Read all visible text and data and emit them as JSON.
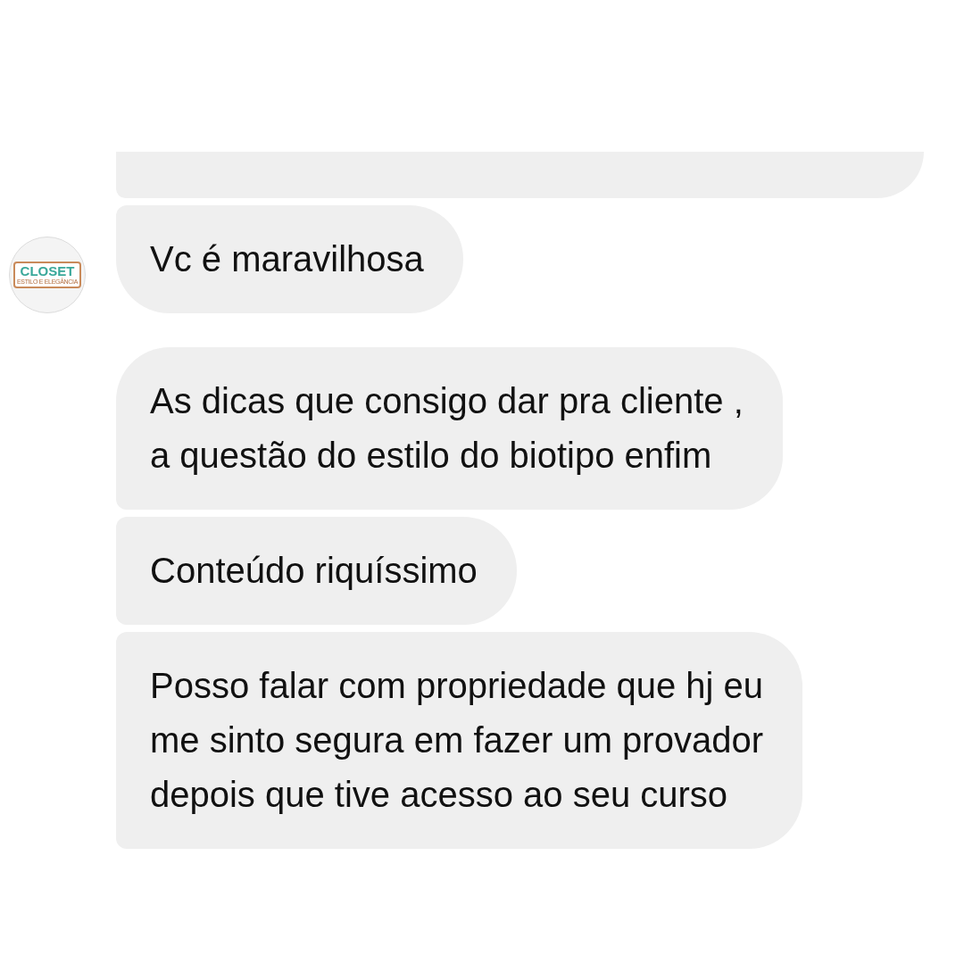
{
  "messages": [
    {
      "group_end": false,
      "cut_top": true
    },
    {
      "lines": [
        "Vc é maravilhosa"
      ],
      "group_end": true,
      "cut_top": false
    },
    {
      "lines": [
        "As dicas que consigo dar pra cliente ,",
        "a questão do estilo do biotipo enfim"
      ],
      "group_end": false,
      "cut_top": false
    },
    {
      "lines": [
        "Conteúdo riquíssimo"
      ],
      "group_end": false,
      "cut_top": false
    },
    {
      "lines": [
        "Posso falar com propriedade que hj eu",
        "me sinto segura em fazer um provador",
        "depois que tive acesso ao seu curso"
      ],
      "group_end": false,
      "cut_top": false
    }
  ],
  "avatar": {
    "logo": "CLOSET",
    "tagline": "ESTILO E ELEGÂNCIA"
  }
}
